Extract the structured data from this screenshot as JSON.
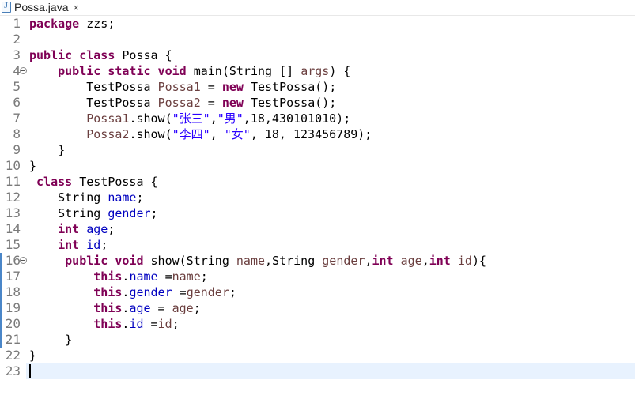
{
  "tab": {
    "title": "Possa.java",
    "icon": "java-file-icon",
    "close": "×"
  },
  "colors": {
    "keyword": "#7f0055",
    "field": "#0000c0",
    "variable": "#6a3e3e",
    "string": "#2a00ff",
    "current_line": "#e8f2fe"
  },
  "lines": [
    {
      "n": "1",
      "tokens": [
        [
          "kw",
          "package"
        ],
        [
          "p",
          " zzs;"
        ]
      ]
    },
    {
      "n": "2",
      "tokens": []
    },
    {
      "n": "3",
      "tokens": [
        [
          "kw",
          "public class"
        ],
        [
          "p",
          " Possa {"
        ]
      ]
    },
    {
      "n": "4",
      "fold": true,
      "tokens": [
        [
          "p",
          "    "
        ],
        [
          "kw",
          "public static void"
        ],
        [
          "p",
          " main(String [] "
        ],
        [
          "var",
          "args"
        ],
        [
          "p",
          ") {"
        ]
      ]
    },
    {
      "n": "5",
      "tokens": [
        [
          "p",
          "        TestPossa "
        ],
        [
          "var",
          "Possa1"
        ],
        [
          "p",
          " = "
        ],
        [
          "kw",
          "new"
        ],
        [
          "p",
          " TestPossa();"
        ]
      ]
    },
    {
      "n": "6",
      "tokens": [
        [
          "p",
          "        TestPossa "
        ],
        [
          "var",
          "Possa2"
        ],
        [
          "p",
          " = "
        ],
        [
          "kw",
          "new"
        ],
        [
          "p",
          " TestPossa();"
        ]
      ]
    },
    {
      "n": "7",
      "tokens": [
        [
          "p",
          "        "
        ],
        [
          "var",
          "Possa1"
        ],
        [
          "p",
          ".show("
        ],
        [
          "str",
          "\"张三\""
        ],
        [
          "p",
          ","
        ],
        [
          "str",
          "\"男\""
        ],
        [
          "p",
          ",18,430101010);"
        ]
      ]
    },
    {
      "n": "8",
      "tokens": [
        [
          "p",
          "        "
        ],
        [
          "var",
          "Possa2"
        ],
        [
          "p",
          ".show("
        ],
        [
          "str",
          "\"李四\""
        ],
        [
          "p",
          ", "
        ],
        [
          "str",
          "\"女\""
        ],
        [
          "p",
          ", 18, 123456789);"
        ]
      ]
    },
    {
      "n": "9",
      "tokens": [
        [
          "p",
          "    }"
        ]
      ]
    },
    {
      "n": "10",
      "tokens": [
        [
          "p",
          "}"
        ]
      ]
    },
    {
      "n": "11",
      "tokens": [
        [
          "p",
          " "
        ],
        [
          "kw",
          "class"
        ],
        [
          "p",
          " TestPossa {"
        ]
      ]
    },
    {
      "n": "12",
      "tokens": [
        [
          "p",
          "    String "
        ],
        [
          "fld",
          "name"
        ],
        [
          "p",
          ";"
        ]
      ]
    },
    {
      "n": "13",
      "tokens": [
        [
          "p",
          "    String "
        ],
        [
          "fld",
          "gender"
        ],
        [
          "p",
          ";"
        ]
      ]
    },
    {
      "n": "14",
      "tokens": [
        [
          "p",
          "    "
        ],
        [
          "kw",
          "int"
        ],
        [
          "p",
          " "
        ],
        [
          "fld",
          "age"
        ],
        [
          "p",
          ";"
        ]
      ]
    },
    {
      "n": "15",
      "tokens": [
        [
          "p",
          "    "
        ],
        [
          "kw",
          "int"
        ],
        [
          "p",
          " "
        ],
        [
          "fld",
          "id"
        ],
        [
          "p",
          ";"
        ]
      ]
    },
    {
      "n": "16",
      "fold": true,
      "mark": true,
      "tokens": [
        [
          "p",
          "     "
        ],
        [
          "kw",
          "public void"
        ],
        [
          "p",
          " show(String "
        ],
        [
          "var",
          "name"
        ],
        [
          "p",
          ",String "
        ],
        [
          "var",
          "gender"
        ],
        [
          "p",
          ","
        ],
        [
          "kw",
          "int"
        ],
        [
          "p",
          " "
        ],
        [
          "var",
          "age"
        ],
        [
          "p",
          ","
        ],
        [
          "kw",
          "int"
        ],
        [
          "p",
          " "
        ],
        [
          "var",
          "id"
        ],
        [
          "p",
          "){"
        ]
      ]
    },
    {
      "n": "17",
      "mark": true,
      "tokens": [
        [
          "p",
          "         "
        ],
        [
          "kw",
          "this"
        ],
        [
          "p",
          "."
        ],
        [
          "fld",
          "name"
        ],
        [
          "p",
          " ="
        ],
        [
          "var",
          "name"
        ],
        [
          "p",
          ";"
        ]
      ]
    },
    {
      "n": "18",
      "mark": true,
      "tokens": [
        [
          "p",
          "         "
        ],
        [
          "kw",
          "this"
        ],
        [
          "p",
          "."
        ],
        [
          "fld",
          "gender"
        ],
        [
          "p",
          " ="
        ],
        [
          "var",
          "gender"
        ],
        [
          "p",
          ";"
        ]
      ]
    },
    {
      "n": "19",
      "mark": true,
      "tokens": [
        [
          "p",
          "         "
        ],
        [
          "kw",
          "this"
        ],
        [
          "p",
          "."
        ],
        [
          "fld",
          "age"
        ],
        [
          "p",
          " = "
        ],
        [
          "var",
          "age"
        ],
        [
          "p",
          ";"
        ]
      ]
    },
    {
      "n": "20",
      "mark": true,
      "tokens": [
        [
          "p",
          "         "
        ],
        [
          "kw",
          "this"
        ],
        [
          "p",
          "."
        ],
        [
          "fld",
          "id"
        ],
        [
          "p",
          " ="
        ],
        [
          "var",
          "id"
        ],
        [
          "p",
          ";"
        ]
      ]
    },
    {
      "n": "21",
      "mark": true,
      "tokens": [
        [
          "p",
          "     }"
        ]
      ]
    },
    {
      "n": "22",
      "tokens": [
        [
          "p",
          "}"
        ]
      ]
    },
    {
      "n": "23",
      "current": true,
      "tokens": []
    }
  ]
}
